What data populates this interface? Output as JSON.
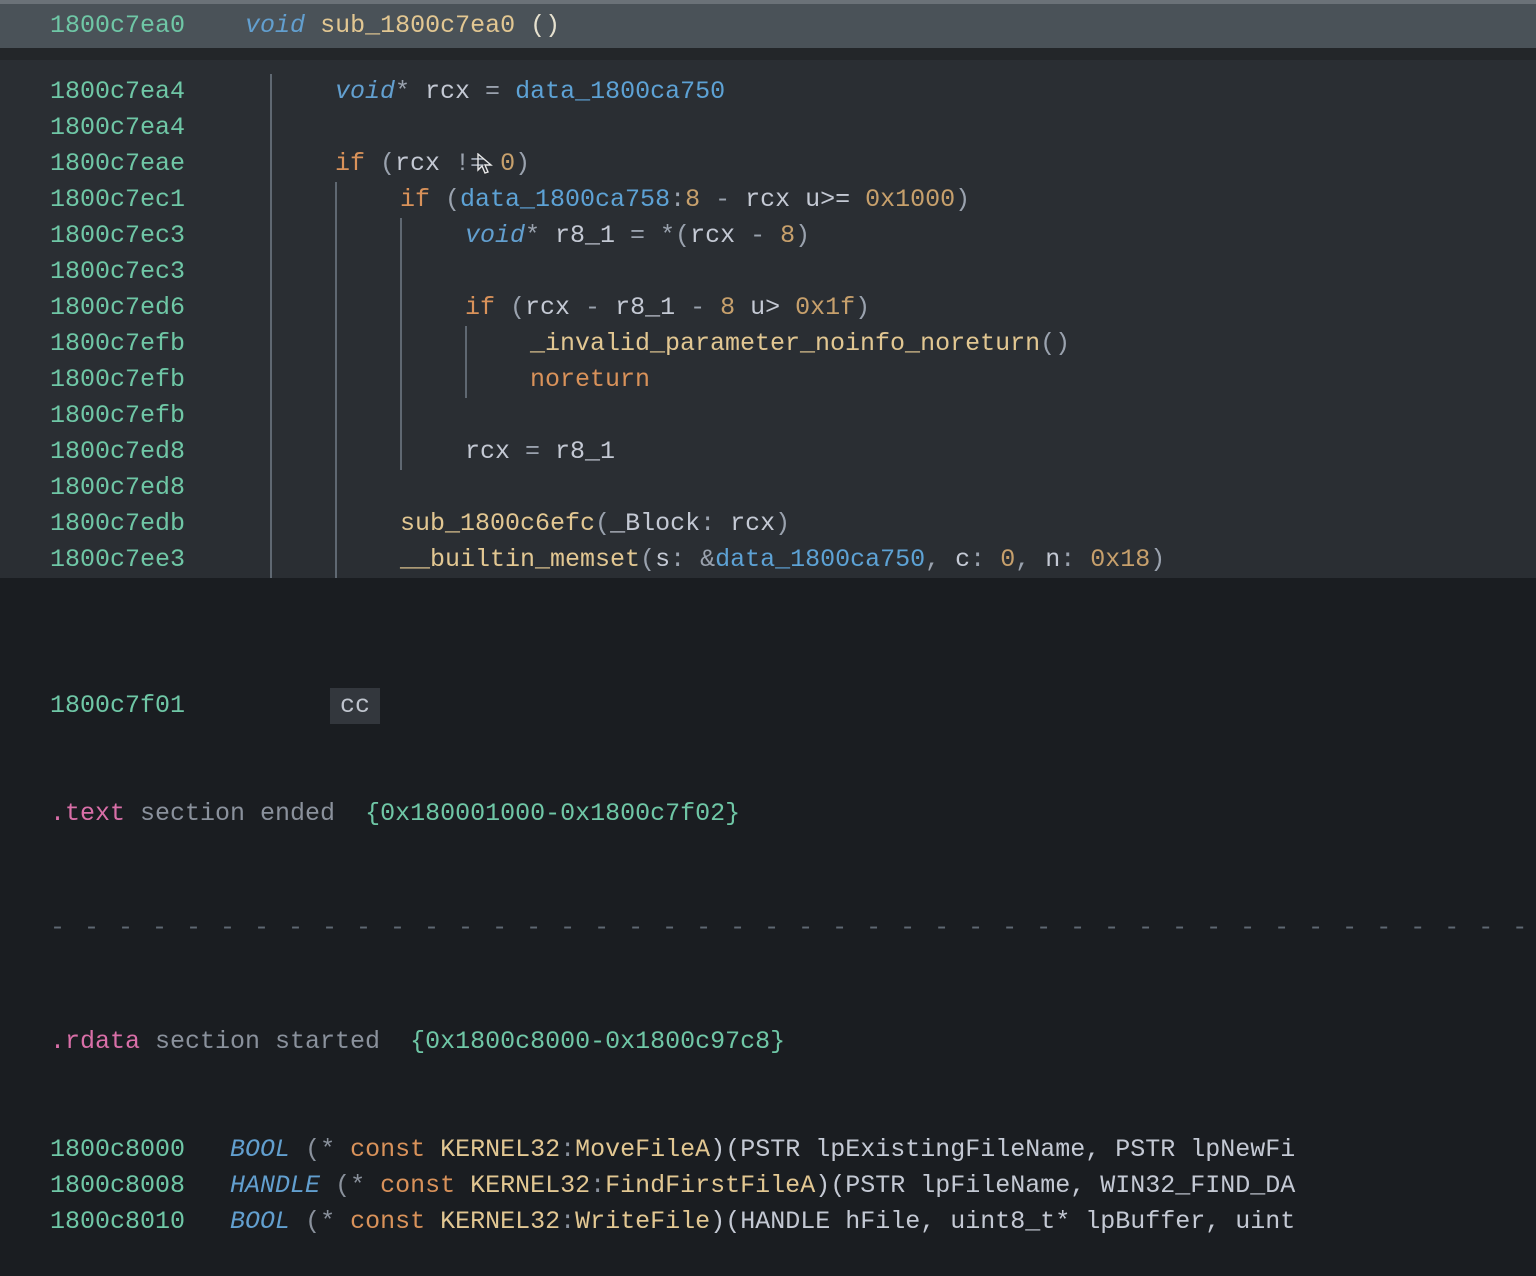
{
  "header": {
    "addr": "1800c7ea0",
    "sig_prefix_type": "void",
    "func_name": "sub_1800c7ea0",
    "sig_parens": "()"
  },
  "lines": [
    {
      "addr": "1800c7ea4",
      "indent": 1,
      "tokens": [
        {
          "c": "ty",
          "t": "void"
        },
        {
          "c": "sym",
          "t": "* "
        },
        {
          "c": "plain",
          "t": "rcx "
        },
        {
          "c": "sym",
          "t": "= "
        },
        {
          "c": "fn",
          "t": "data_1800ca750"
        }
      ]
    },
    {
      "addr": "1800c7ea4",
      "indent": 1,
      "tokens": []
    },
    {
      "addr": "1800c7eae",
      "indent": 1,
      "tokens": [
        {
          "c": "kw",
          "t": "if"
        },
        {
          "c": "sym",
          "t": " ("
        },
        {
          "c": "plain",
          "t": "rcx "
        },
        {
          "c": "sym",
          "t": "!= "
        },
        {
          "c": "num",
          "t": "0"
        },
        {
          "c": "sym",
          "t": ")"
        }
      ]
    },
    {
      "addr": "1800c7ec1",
      "indent": 2,
      "tokens": [
        {
          "c": "kw",
          "t": "if"
        },
        {
          "c": "sym",
          "t": " ("
        },
        {
          "c": "fn",
          "t": "data_1800ca758"
        },
        {
          "c": "sym",
          "t": ":"
        },
        {
          "c": "num",
          "t": "8"
        },
        {
          "c": "sym",
          "t": " - "
        },
        {
          "c": "plain",
          "t": "rcx "
        },
        {
          "c": "plain",
          "t": "u>= "
        },
        {
          "c": "num",
          "t": "0x1000"
        },
        {
          "c": "sym",
          "t": ")"
        }
      ]
    },
    {
      "addr": "1800c7ec3",
      "indent": 3,
      "tokens": [
        {
          "c": "ty",
          "t": "void"
        },
        {
          "c": "sym",
          "t": "* "
        },
        {
          "c": "plain",
          "t": "r8_1 "
        },
        {
          "c": "sym",
          "t": "= *("
        },
        {
          "c": "plain",
          "t": "rcx "
        },
        {
          "c": "sym",
          "t": "- "
        },
        {
          "c": "num",
          "t": "8"
        },
        {
          "c": "sym",
          "t": ")"
        }
      ]
    },
    {
      "addr": "1800c7ec3",
      "indent": 3,
      "tokens": []
    },
    {
      "addr": "1800c7ed6",
      "indent": 3,
      "tokens": [
        {
          "c": "kw",
          "t": "if"
        },
        {
          "c": "sym",
          "t": " ("
        },
        {
          "c": "plain",
          "t": "rcx "
        },
        {
          "c": "sym",
          "t": "- "
        },
        {
          "c": "plain",
          "t": "r8_1 "
        },
        {
          "c": "sym",
          "t": "- "
        },
        {
          "c": "num",
          "t": "8"
        },
        {
          "c": "plain",
          "t": " u> "
        },
        {
          "c": "num",
          "t": "0x1f"
        },
        {
          "c": "sym",
          "t": ")"
        }
      ]
    },
    {
      "addr": "1800c7efb",
      "indent": 4,
      "tokens": [
        {
          "c": "call",
          "t": "_invalid_parameter_noinfo_noreturn"
        },
        {
          "c": "sym",
          "t": "()"
        }
      ]
    },
    {
      "addr": "1800c7efb",
      "indent": 4,
      "tokens": [
        {
          "c": "kw",
          "t": "noreturn"
        }
      ]
    },
    {
      "addr": "1800c7efb",
      "indent": 3,
      "tokens": []
    },
    {
      "addr": "1800c7ed8",
      "indent": 3,
      "tokens": [
        {
          "c": "plain",
          "t": "rcx "
        },
        {
          "c": "sym",
          "t": "= "
        },
        {
          "c": "plain",
          "t": "r8_1"
        }
      ]
    },
    {
      "addr": "1800c7ed8",
      "indent": 2,
      "tokens": []
    },
    {
      "addr": "1800c7edb",
      "indent": 2,
      "tokens": [
        {
          "c": "call",
          "t": "sub_1800c6efc"
        },
        {
          "c": "sym",
          "t": "("
        },
        {
          "c": "plain",
          "t": "_Block"
        },
        {
          "c": "sym",
          "t": ": "
        },
        {
          "c": "plain",
          "t": "rcx"
        },
        {
          "c": "sym",
          "t": ")"
        }
      ]
    },
    {
      "addr": "1800c7ee3",
      "indent": 2,
      "tokens": [
        {
          "c": "call",
          "t": "__builtin_memset"
        },
        {
          "c": "sym",
          "t": "("
        },
        {
          "c": "plain",
          "t": "s"
        },
        {
          "c": "sym",
          "t": ": &"
        },
        {
          "c": "fn",
          "t": "data_1800ca750"
        },
        {
          "c": "sym",
          "t": ", "
        },
        {
          "c": "plain",
          "t": "c"
        },
        {
          "c": "sym",
          "t": ": "
        },
        {
          "c": "num",
          "t": "0"
        },
        {
          "c": "sym",
          "t": ", "
        },
        {
          "c": "plain",
          "t": "n"
        },
        {
          "c": "sym",
          "t": ": "
        },
        {
          "c": "num",
          "t": "0x18"
        },
        {
          "c": "sym",
          "t": ")"
        }
      ]
    }
  ],
  "lower": {
    "int3": {
      "addr": "1800c7f01",
      "opcode": "cc"
    },
    "text_end": {
      "section": ".text",
      "label": " section ended  ",
      "range": "{0x180001000-0x1800c7f02}"
    },
    "rdata_start": {
      "section": ".rdata",
      "label": " section started  ",
      "range": "{0x1800c8000-0x1800c97c8}"
    },
    "imports": [
      {
        "addr": "1800c8000",
        "ret": "BOOL",
        "mod": "KERNEL32",
        "fn": "MoveFileA",
        "tail": ")(PSTR lpExistingFileName, PSTR lpNewFi"
      },
      {
        "addr": "1800c8008",
        "ret": "HANDLE",
        "mod": "KERNEL32",
        "fn": "FindFirstFileA",
        "tail": ")(PSTR lpFileName, WIN32_FIND_DA"
      },
      {
        "addr": "1800c8010",
        "ret": "BOOL",
        "mod": "KERNEL32",
        "fn": "WriteFile",
        "tail": ")(HANDLE hFile, uint8_t* lpBuffer, uint"
      }
    ]
  }
}
